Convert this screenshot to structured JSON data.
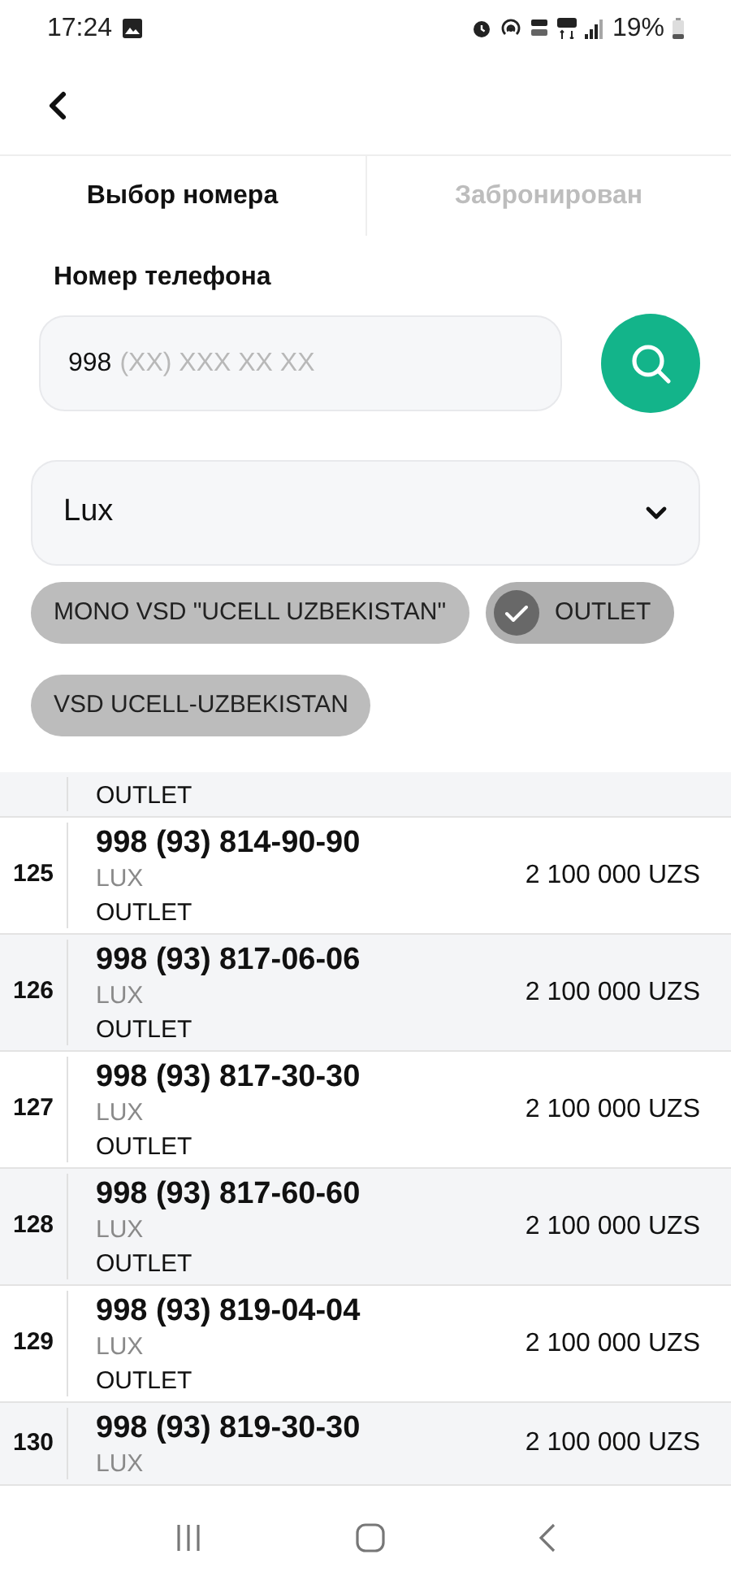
{
  "status_bar": {
    "time": "17:24",
    "battery": "19%"
  },
  "tabs": [
    {
      "label": "Выбор номера",
      "selected": true
    },
    {
      "label": "Забронирован",
      "selected": false
    }
  ],
  "phone_field": {
    "label": "Номер телефона",
    "value": "998",
    "placeholder": "(XX) XXX XX XX"
  },
  "category_select": {
    "value": "Lux"
  },
  "chips": [
    {
      "label": "MONO VSD \"UCELL UZBEKISTAN\"",
      "selected": false
    },
    {
      "label": "OUTLET",
      "selected": true
    },
    {
      "label": "VSD UCELL-UZBEKISTAN",
      "selected": false
    }
  ],
  "numbers": [
    {
      "tag": "OUTLET"
    },
    {
      "index": "125",
      "phone": "998 (93) 814-90-90",
      "category": "LUX",
      "tag": "OUTLET",
      "price": "2 100 000 UZS"
    },
    {
      "index": "126",
      "phone": "998 (93) 817-06-06",
      "category": "LUX",
      "tag": "OUTLET",
      "price": "2 100 000 UZS"
    },
    {
      "index": "127",
      "phone": "998 (93) 817-30-30",
      "category": "LUX",
      "tag": "OUTLET",
      "price": "2 100 000 UZS"
    },
    {
      "index": "128",
      "phone": "998 (93) 817-60-60",
      "category": "LUX",
      "tag": "OUTLET",
      "price": "2 100 000 UZS"
    },
    {
      "index": "129",
      "phone": "998 (93) 819-04-04",
      "category": "LUX",
      "tag": "OUTLET",
      "price": "2 100 000 UZS"
    },
    {
      "index": "130",
      "phone": "998 (93) 819-30-30",
      "category": "LUX",
      "price": "2 100 000 UZS"
    }
  ]
}
